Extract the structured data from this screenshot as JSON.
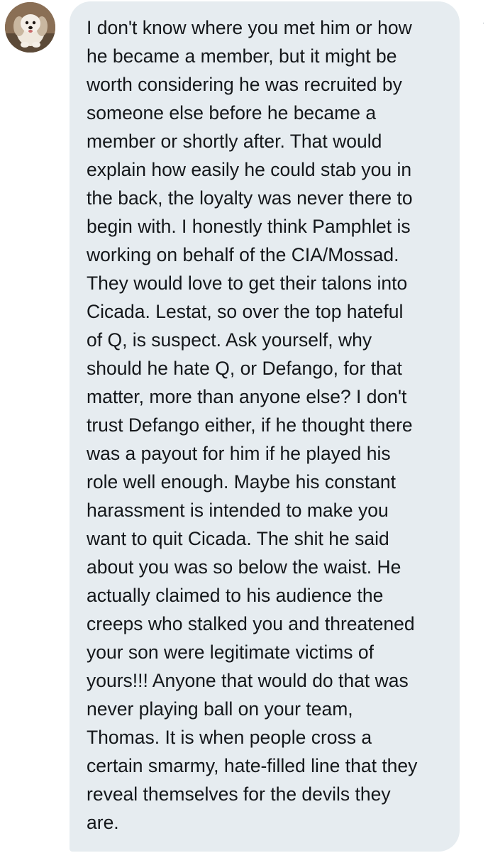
{
  "avatar": {
    "icon": "dog-photo-avatar"
  },
  "message": {
    "lines": [
      "I don't know where you met him or how",
      "he became a member, but it might be",
      "worth considering he was recruited by",
      "someone else before he became a",
      "member or shortly after. That would",
      "explain how easily he could stab you in",
      "the back, the loyalty was never there to",
      "begin with. I honestly think Pamphlet is",
      "working on behalf of the CIA/Mossad.",
      "They would love to get their talons into",
      "Cicada. Lestat, so over the top hateful",
      "of Q, is suspect. Ask yourself, why",
      "should he hate Q, or Defango, for that",
      "matter, more than anyone else? I don't",
      "trust Defango either, if he thought there",
      "was a payout for him if he played his",
      "role well enough. Maybe his constant",
      "harassment is intended to make you",
      "want to quit Cicada. The shit he said",
      "about you was so below the waist. He",
      "actually claimed to his audience the",
      "creeps who stalked you and threatened",
      "your son were legitimate victims of",
      "yours!!! Anyone that would do that was",
      "never playing ball on your team,",
      "Thomas. It is when people cross a",
      "certain smarmy, hate-filled line that they",
      "reveal themselves for the devils they",
      "are."
    ]
  },
  "colors": {
    "bubble_background": "#e6ecf0",
    "text": "#14171a"
  }
}
